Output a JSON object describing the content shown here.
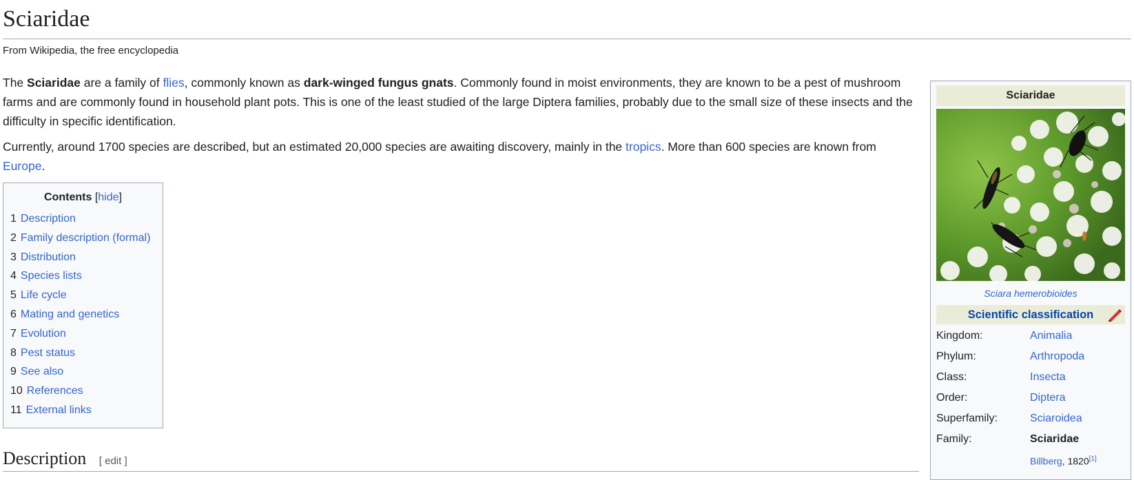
{
  "article": {
    "title": "Sciaridae",
    "tagline": "From Wikipedia, the free encyclopedia",
    "p1": {
      "t1": "The ",
      "b1": "Sciaridae",
      "t2": " are a family of ",
      "link_flies": "flies",
      "t3": ", commonly known as ",
      "b2": "dark-winged fungus gnats",
      "t4": ". Commonly found in moist environments, they are known to be a pest of mushroom farms and are commonly found in household plant pots. This is one of the least studied of the large Diptera families, probably due to the small size of these insects and the difficulty in specific identification."
    },
    "p2": {
      "t1": "Currently, around 1700 species are described, but an estimated 20,000 species are awaiting discovery, mainly in the ",
      "link_tropics": "tropics",
      "t2": ". More than 600 species are known from ",
      "link_europe": "Europe",
      "t3": "."
    }
  },
  "toc": {
    "title": "Contents",
    "bracket_open": "[",
    "hide": "hide",
    "bracket_close": "]",
    "items": [
      {
        "num": "1",
        "label": "Description"
      },
      {
        "num": "2",
        "label": "Family description (formal)"
      },
      {
        "num": "3",
        "label": "Distribution"
      },
      {
        "num": "4",
        "label": "Species lists"
      },
      {
        "num": "5",
        "label": "Life cycle"
      },
      {
        "num": "6",
        "label": "Mating and genetics"
      },
      {
        "num": "7",
        "label": "Evolution"
      },
      {
        "num": "8",
        "label": "Pest status"
      },
      {
        "num": "9",
        "label": "See also"
      },
      {
        "num": "10",
        "label": "References"
      },
      {
        "num": "11",
        "label": "External links"
      }
    ]
  },
  "section": {
    "heading": "Description",
    "edit": "[ edit ]"
  },
  "infobox": {
    "title": "Sciaridae",
    "caption": "Sciara hemerobioides",
    "classification": "Scientific classification",
    "rows": [
      {
        "label": "Kingdom:",
        "value": "Animalia"
      },
      {
        "label": "Phylum:",
        "value": "Arthropoda"
      },
      {
        "label": "Class:",
        "value": "Insecta"
      },
      {
        "label": "Order:",
        "value": "Diptera"
      },
      {
        "label": "Superfamily:",
        "value": "Sciaroidea"
      },
      {
        "label": "Family:",
        "value": "Sciaridae"
      }
    ],
    "authority": {
      "name": "Billberg",
      "year": ", 1820",
      "ref": "[1]"
    }
  },
  "colors": {
    "link": "#3366cc",
    "header_bg": "#eaecd8",
    "box_bg": "#f8f9fa",
    "border": "#a2a9b1"
  },
  "icons": {
    "edit_classification": "pencil-icon"
  }
}
